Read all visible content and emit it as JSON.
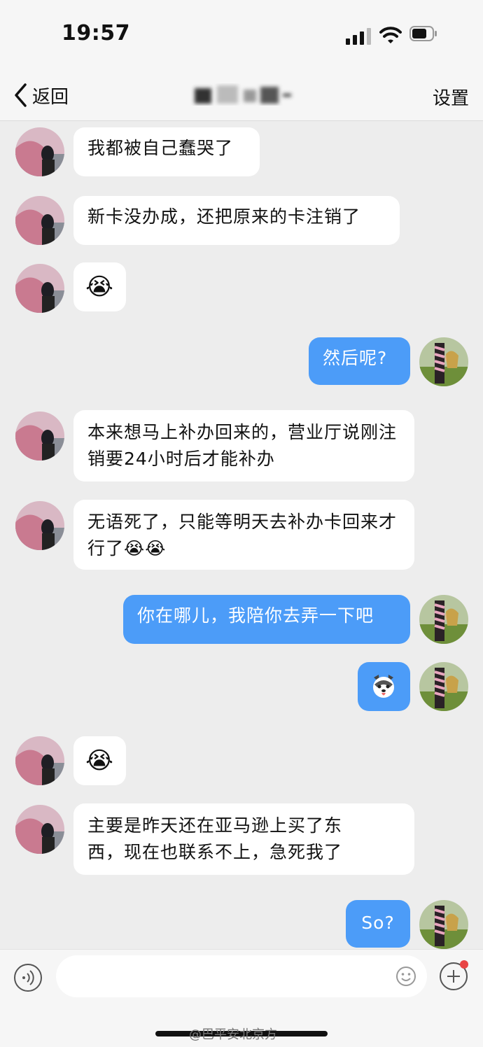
{
  "status_bar": {
    "time": "19:57",
    "icons": [
      "cellular-signal-icon",
      "wifi-icon",
      "battery-icon"
    ]
  },
  "nav": {
    "back_label": "返回",
    "settings_label": "设置"
  },
  "messages": [
    {
      "side": "in",
      "text": "我都被自己蠢哭了"
    },
    {
      "side": "in",
      "text": "新卡没办成，还把原来的卡注销了"
    },
    {
      "side": "in",
      "text": "😭"
    },
    {
      "side": "out",
      "text": "然后呢?"
    },
    {
      "side": "in",
      "text": "本来想马上补办回来的，营业厅说刚注销要24小时后才能补办"
    },
    {
      "side": "in",
      "text": "无语死了，只能等明天去补办卡回来才行了😭😭"
    },
    {
      "side": "out",
      "text": "你在哪儿，我陪你去弄一下吧"
    },
    {
      "side": "out",
      "text": "sticker-husky",
      "sticker": true
    },
    {
      "side": "in",
      "text": "😭"
    },
    {
      "side": "in",
      "text": "主要是昨天还在亚马逊上买了东西，现在也联系不上，急死我了"
    },
    {
      "side": "out",
      "text": "So?"
    }
  ],
  "input_bar": {
    "icons": [
      "voice-icon",
      "emoji-icon",
      "plus-icon"
    ]
  },
  "watermark": "@巴平安北京方",
  "colors": {
    "outgoing_bubble": "#4C9CF8",
    "incoming_bubble": "#FFFFFF",
    "background": "#EDEDED",
    "bar": "#F6F6F6"
  }
}
